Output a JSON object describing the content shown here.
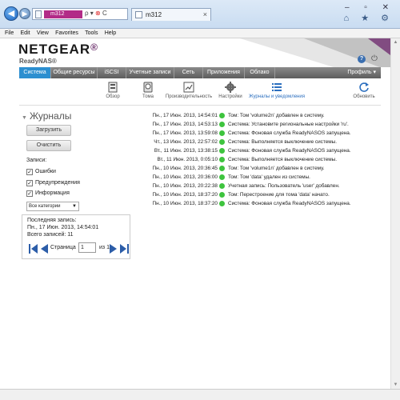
{
  "browser": {
    "address_text": "m312",
    "address_controls": "ρ ▾ ",
    "address_stop": "⊗",
    "address_extra": " C",
    "tab_label": "m312",
    "tab_close": "×",
    "window_controls": "– ▫ ✕",
    "tool_icons": "⌂ ★ ⚙"
  },
  "menubar": [
    "File",
    "Edit",
    "View",
    "Favorites",
    "Tools",
    "Help"
  ],
  "header": {
    "logo": "NETGEAR",
    "logo_mark": "®",
    "product": "ReadyNAS®"
  },
  "nav": {
    "tabs": [
      "Система",
      "Общие ресурсы",
      "iSCSI",
      "Учетные записи",
      "Сеть",
      "Приложения",
      "Облако"
    ],
    "active": "Система",
    "profile": "Профиль ▾"
  },
  "toolbar": {
    "items": [
      "Обзор",
      "Тома",
      "Производительность",
      "Настройки",
      "Журналы и уведомления"
    ],
    "active": "Журналы и уведомления",
    "refresh": "Обновить"
  },
  "left": {
    "title": "Журналы",
    "download_btn": "Загрузить",
    "clear_btn": "Очистить",
    "records_label": "Записи:",
    "checks": [
      {
        "label": "Ошибки",
        "checked": true
      },
      {
        "label": "Предупреждения",
        "checked": true
      },
      {
        "label": "Информация",
        "checked": true
      }
    ],
    "category_select": "Все категории",
    "last_record_label": "Последняя запись:",
    "last_record_date": "Пн., 17 Июн. 2013, 14:54:01",
    "total_records": "Всего записей: 11",
    "page_label": "Страница",
    "page_value": "1",
    "page_of": "из 1"
  },
  "logs": [
    {
      "ts": "Пн., 17 Июн. 2013, 14:54:01",
      "msg": "Том: Том 'volume2n' добавлен в систему."
    },
    {
      "ts": "Пн., 17 Июн. 2013, 14:53:13",
      "msg": "Система: Установите региональные настройки 'ru'."
    },
    {
      "ts": "Пн., 17 Июн. 2013, 13:59:08",
      "msg": "Система: Фоновая служба ReadyNASOS запущена."
    },
    {
      "ts": "Чт., 13 Июн. 2013, 22:57:02",
      "msg": "Система: Выполняется выключение системы."
    },
    {
      "ts": "Вт., 11 Июн. 2013, 13:38:15",
      "msg": "Система: Фоновая служба ReadyNASOS запущена."
    },
    {
      "ts": "Вт., 11 Июн. 2013, 0:05:10",
      "msg": "Система: Выполняется выключение системы."
    },
    {
      "ts": "Пн., 10 Июн. 2013, 20:36:45",
      "msg": "Том: Том 'volume1n' добавлен в систему."
    },
    {
      "ts": "Пн., 10 Июн. 2013, 20:36:00",
      "msg": "Том: Том 'data' удален из системы."
    },
    {
      "ts": "Пн., 10 Июн. 2013, 20:22:38",
      "msg": "Учетная запись: Пользователь 'user' добавлен."
    },
    {
      "ts": "Пн., 10 Июн. 2013, 18:37:20",
      "msg": "Том: Перестроение для тома 'data' начато."
    },
    {
      "ts": "Пн., 10 Июн. 2013, 18:37:20",
      "msg": "Система: Фоновая служба ReadyNASOS запущена."
    }
  ],
  "colors": {
    "accent": "#2c8fd0",
    "status_ok": "#3ec43e",
    "logo_purple": "#6b2d6b"
  }
}
